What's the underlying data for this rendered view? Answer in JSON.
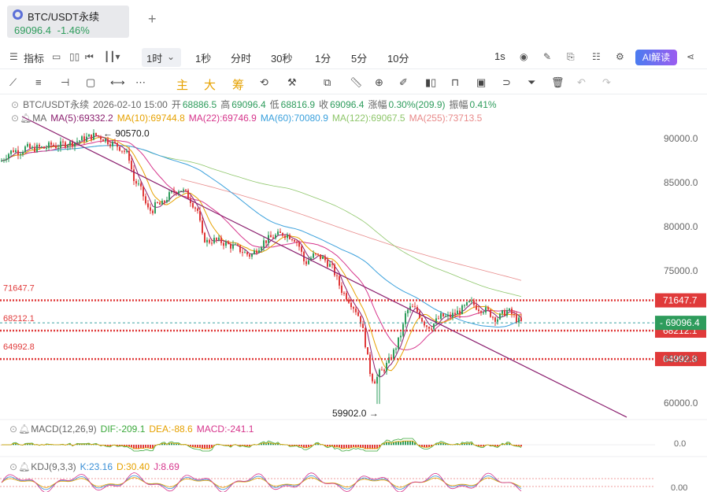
{
  "tab": {
    "title": "BTC/USDT永续",
    "price": "69096.4",
    "change": "-1.46%",
    "add": "+"
  },
  "toolbar1": {
    "indicators": "指标",
    "intervals": [
      "1时",
      "1秒",
      "分时",
      "30秒",
      "1分",
      "5分",
      "10分"
    ],
    "speed": "1s",
    "ai": "AI解读"
  },
  "toolbar2": {
    "chars": [
      "主",
      "大",
      "筹"
    ]
  },
  "legend": {
    "ohlc": {
      "symbol": "BTC/USDT永续",
      "datetime": "2026-02-10 15:00",
      "open_label": "开",
      "open": "68886.5",
      "high_label": "高",
      "high": "69096.4",
      "low_label": "低",
      "low": "68816.9",
      "close_label": "收",
      "close": "69096.4",
      "chg_label": "涨幅",
      "chg": "0.30%(209.9)",
      "amp_label": "振幅",
      "amp": "0.41%"
    },
    "ma": {
      "name": "MA",
      "items": [
        {
          "text": "MA(5):69332.2",
          "color": "#8a1e6e"
        },
        {
          "text": "MA(10):69744.8",
          "color": "#e6a100"
        },
        {
          "text": "MA(22):69746.9",
          "color": "#d6358c"
        },
        {
          "text": "MA(60):70080.9",
          "color": "#3aa0dc"
        },
        {
          "text": "MA(122):69067.5",
          "color": "#8ec66a"
        },
        {
          "text": "MA(255):73713.5",
          "color": "#e88a8a"
        }
      ]
    },
    "macd": {
      "name": "MACD(12,26,9)",
      "dif": "DIF:-209.1",
      "dea": "DEA:-88.6",
      "macd": "MACD:-241.1",
      "axis": "0.0"
    },
    "kdj": {
      "name": "KDJ(9,3,3)",
      "k": "K:23.16",
      "d": "D:30.40",
      "j": "J:8.69",
      "axis": "0.00"
    }
  },
  "chart_data": {
    "type": "candlestick",
    "interval": "1h",
    "yticks": [
      90000.0,
      85000.0,
      80000.0,
      75000.0,
      70000.0,
      65000.0,
      60000.0
    ],
    "ytick_labels": [
      "90000.0",
      "85000.0",
      "80000.0",
      "75000.0",
      "70000.0",
      "65000.0",
      "60000.0"
    ],
    "ylim": [
      57700,
      92100
    ],
    "current_price": "69096.4",
    "current_price_value": 69096.4,
    "horizontal_levels": [
      {
        "value": 71647.7,
        "label": "71647.7"
      },
      {
        "value": 68212.1,
        "label": "68212.1"
      },
      {
        "value": 64992.8,
        "label": "64992.8"
      }
    ],
    "annotations": [
      {
        "text": "90570.0",
        "value": 90570.0
      },
      {
        "text": "59902.0",
        "value": 59902.0
      }
    ],
    "trendline": {
      "from": 92500,
      "to": 58400
    },
    "path_points": [
      [
        0,
        87400
      ],
      [
        8,
        88200
      ],
      [
        16,
        88700
      ],
      [
        24,
        88500
      ],
      [
        32,
        89000
      ],
      [
        40,
        88800
      ],
      [
        48,
        89000
      ],
      [
        56,
        88900
      ],
      [
        64,
        89300
      ],
      [
        72,
        89100
      ],
      [
        80,
        89400
      ],
      [
        90,
        89500
      ],
      [
        100,
        89800
      ],
      [
        110,
        90100
      ],
      [
        120,
        90400
      ],
      [
        128,
        90100
      ],
      [
        138,
        89600
      ],
      [
        148,
        89200
      ],
      [
        158,
        88500
      ],
      [
        164,
        87700
      ],
      [
        168,
        85300
      ],
      [
        174,
        84800
      ],
      [
        180,
        83800
      ],
      [
        186,
        82000
      ],
      [
        192,
        81800
      ],
      [
        198,
        82600
      ],
      [
        204,
        82400
      ],
      [
        212,
        83400
      ],
      [
        220,
        84000
      ],
      [
        228,
        84300
      ],
      [
        236,
        83700
      ],
      [
        244,
        82600
      ],
      [
        250,
        81800
      ],
      [
        256,
        78900
      ],
      [
        262,
        78300
      ],
      [
        270,
        78500
      ],
      [
        280,
        78300
      ],
      [
        290,
        77900
      ],
      [
        300,
        77600
      ],
      [
        310,
        77000
      ],
      [
        318,
        76700
      ],
      [
        326,
        77600
      ],
      [
        334,
        78300
      ],
      [
        342,
        78700
      ],
      [
        350,
        79000
      ],
      [
        358,
        79200
      ],
      [
        366,
        79000
      ],
      [
        374,
        78600
      ],
      [
        380,
        77600
      ],
      [
        386,
        75800
      ],
      [
        392,
        76300
      ],
      [
        398,
        76800
      ],
      [
        404,
        76600
      ],
      [
        410,
        76400
      ],
      [
        416,
        75800
      ],
      [
        422,
        75200
      ],
      [
        428,
        73800
      ],
      [
        434,
        72600
      ],
      [
        440,
        72000
      ],
      [
        446,
        71200
      ],
      [
        452,
        70400
      ],
      [
        458,
        69100
      ],
      [
        464,
        66300
      ],
      [
        468,
        63800
      ],
      [
        472,
        62800
      ],
      [
        476,
        62500
      ],
      [
        480,
        63300
      ],
      [
        486,
        63800
      ],
      [
        492,
        64600
      ],
      [
        498,
        65600
      ],
      [
        504,
        66800
      ],
      [
        510,
        68300
      ],
      [
        514,
        70000
      ],
      [
        518,
        70700
      ],
      [
        524,
        70800
      ],
      [
        530,
        70300
      ],
      [
        536,
        69300
      ],
      [
        542,
        68700
      ],
      [
        548,
        68800
      ],
      [
        554,
        69400
      ],
      [
        560,
        69900
      ],
      [
        566,
        69700
      ],
      [
        572,
        69900
      ],
      [
        578,
        70200
      ],
      [
        584,
        70500
      ],
      [
        590,
        70900
      ],
      [
        596,
        71400
      ],
      [
        602,
        71100
      ],
      [
        608,
        70700
      ],
      [
        614,
        70600
      ],
      [
        620,
        70300
      ],
      [
        626,
        69700
      ],
      [
        632,
        69600
      ],
      [
        638,
        70200
      ],
      [
        644,
        70500
      ],
      [
        650,
        70000
      ],
      [
        656,
        69400
      ],
      [
        662,
        69096
      ]
    ]
  }
}
